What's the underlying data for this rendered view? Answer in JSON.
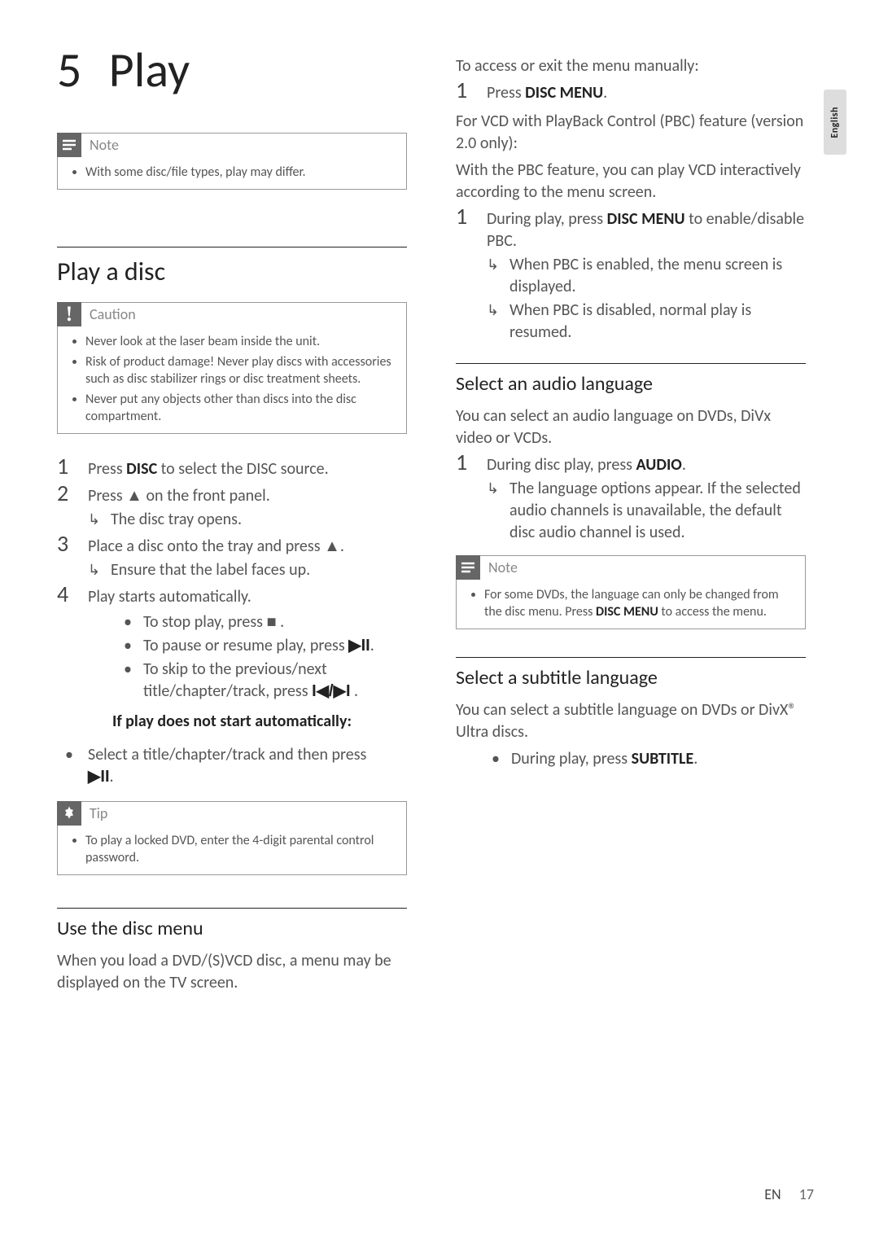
{
  "language_tab": "English",
  "chapter": {
    "number": "5",
    "title": "Play"
  },
  "left_note": {
    "title": "Note",
    "items": [
      "With some disc/file types, play may differ."
    ]
  },
  "play_disc": {
    "heading": "Play a disc",
    "caution": {
      "title": "Caution",
      "items": [
        "Never look at the laser beam inside the unit.",
        "Risk of product damage! Never play discs with accessories such as disc stabilizer rings or disc treatment sheets.",
        "Never put any objects other than discs into the disc compartment."
      ]
    },
    "steps": {
      "s1_a": "Press ",
      "s1_b": "DISC",
      "s1_c": " to select the DISC source.",
      "s2_a": "Press ",
      "s2_eject": "▲",
      "s2_b": " on the front panel.",
      "s2_sub": "The disc tray opens.",
      "s3_a": "Place a disc onto the tray and press ",
      "s3_eject": "▲",
      "s3_b": ".",
      "s3_sub": "Ensure that the label faces up.",
      "s4": "Play starts automatically.",
      "s4_b1_a": "To stop play, press ",
      "s4_b1_icon": "■",
      "s4_b1_b": " .",
      "s4_b2_a": "To pause or resume play, press ",
      "s4_b2_icon": "▶II",
      "s4_b2_b": ".",
      "s4_b3_a": "To skip to the previous/next title/chapter/track, press ",
      "s4_b3_icon": "I◀/▶I",
      "s4_b3_b": " .",
      "ifnot": "If play does not start automatically:",
      "ifnot_item_a": "Select a title/chapter/track and then press ",
      "ifnot_item_icon": "▶II",
      "ifnot_item_b": "."
    },
    "tip": {
      "title": "Tip",
      "items": [
        "To play a locked DVD, enter the 4-digit parental control password."
      ]
    }
  },
  "disc_menu": {
    "heading": "Use the disc menu",
    "intro": "When you load a DVD/(S)VCD disc, a menu may be displayed on the TV screen."
  },
  "right": {
    "manual_heading": "To access or exit the menu manually:",
    "manual_step_a": "Press ",
    "manual_step_b": "DISC MENU",
    "manual_step_c": ".",
    "vcd_heading": "For VCD with PlayBack Control (PBC) feature (version 2.0 only):",
    "vcd_intro": "With the PBC feature, you can play VCD interactively according to the menu screen.",
    "vcd_step_a": "During play, press ",
    "vcd_step_b": "DISC MENU",
    "vcd_step_c": " to enable/disable PBC.",
    "vcd_sub1": "When PBC is enabled, the menu screen is displayed.",
    "vcd_sub2": "When PBC is disabled, normal play is resumed.",
    "audio_heading": "Select an audio language",
    "audio_intro": "You can select an audio language on DVDs, DiVx video or VCDs.",
    "audio_step_a": "During disc play, press ",
    "audio_step_b": "AUDIO",
    "audio_step_c": ".",
    "audio_sub": "The language options appear. If the selected audio channels is unavailable, the default disc audio channel is used.",
    "audio_note_title": "Note",
    "audio_note_item_a": "For some DVDs, the language can only be changed from the disc menu. Press ",
    "audio_note_item_b": "DISC MENU",
    "audio_note_item_c": " to access the menu.",
    "subtitle_heading": "Select a subtitle language",
    "subtitle_intro": "You can select a subtitle language on DVDs or DivX® Ultra discs.",
    "subtitle_item_a": "During play, press ",
    "subtitle_item_b": "SUBTITLE",
    "subtitle_item_c": "."
  },
  "footer": {
    "lang": "EN",
    "page": "17"
  }
}
